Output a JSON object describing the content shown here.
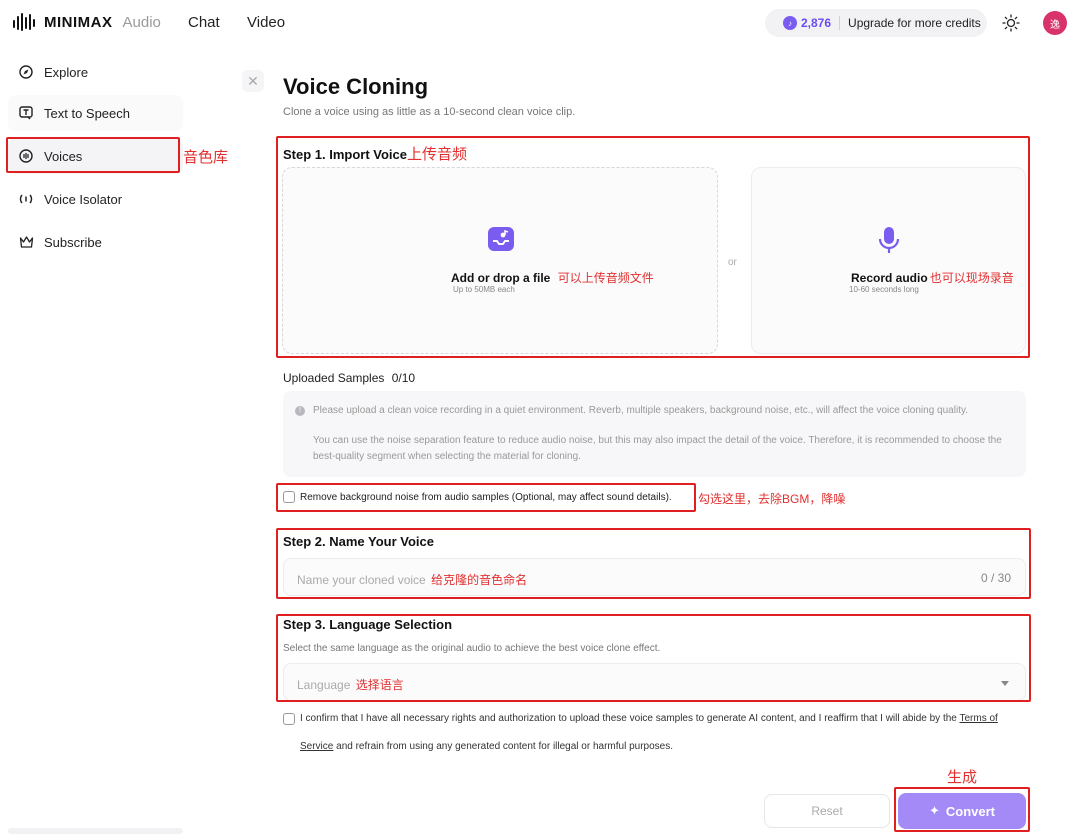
{
  "header": {
    "logo_text": "MINIMAX",
    "logo_sub": "Audio",
    "nav": [
      "Chat",
      "Video"
    ],
    "credits_count": "2,876",
    "upgrade_label": "Upgrade for more credits",
    "avatar_text": "逸"
  },
  "sidebar": {
    "items": [
      {
        "label": "Explore",
        "icon": "compass-icon"
      },
      {
        "label": "Text to Speech",
        "icon": "tts-icon"
      },
      {
        "label": "Voices",
        "icon": "voices-icon"
      },
      {
        "label": "Voice Isolator",
        "icon": "isolator-icon"
      },
      {
        "label": "Subscribe",
        "icon": "crown-icon"
      }
    ],
    "annotation": "音色库"
  },
  "page": {
    "title": "Voice Cloning",
    "subtitle": "Clone a voice using as little as a 10-second clean voice clip."
  },
  "step1": {
    "title": "Step 1. Import Voice",
    "annotation": "上传音频",
    "upload_title": "Add or drop a file",
    "upload_annotation": "可以上传音频文件",
    "upload_sub": "Up to 50MB each",
    "or": "or",
    "record_title": "Record audio",
    "record_annotation": "也可以现场录音",
    "record_sub": "10-60 seconds long"
  },
  "samples": {
    "label": "Uploaded Samples",
    "count": "0/10",
    "info_1": "Please upload a clean voice recording in a quiet environment. Reverb, multiple speakers, background noise, etc., will affect the voice cloning quality.",
    "info_2": "You can use the noise separation feature to reduce audio noise, but this may also impact the detail of the voice. Therefore, it is recommended to choose the best-quality segment when selecting the material for cloning."
  },
  "noise": {
    "label": "Remove background noise from audio samples (Optional, may affect sound details).",
    "annotation": "勾选这里，去除BGM，降噪"
  },
  "step2": {
    "title": "Step 2. Name Your Voice",
    "placeholder": "Name your cloned voice",
    "annotation": "给克隆的音色命名",
    "counter": "0 / 30"
  },
  "step3": {
    "title": "Step 3. Language Selection",
    "hint": "Select the same language as the original audio to achieve the best voice clone effect.",
    "placeholder": "Language",
    "annotation": "选择语言"
  },
  "confirm": {
    "text_1": "I confirm that I have all necessary rights and authorization to upload these voice samples to generate AI content, and I reaffirm that I will abide by the",
    "tos": "Terms of Service",
    "text_2": "and refrain from using any generated content for illegal or harmful purposes."
  },
  "actions": {
    "reset": "Reset",
    "convert": "Convert",
    "annotation": "生成"
  },
  "colors": {
    "accent": "#7b5cf0",
    "convert_bg": "#a48af7",
    "annotation_red": "#e02020"
  }
}
